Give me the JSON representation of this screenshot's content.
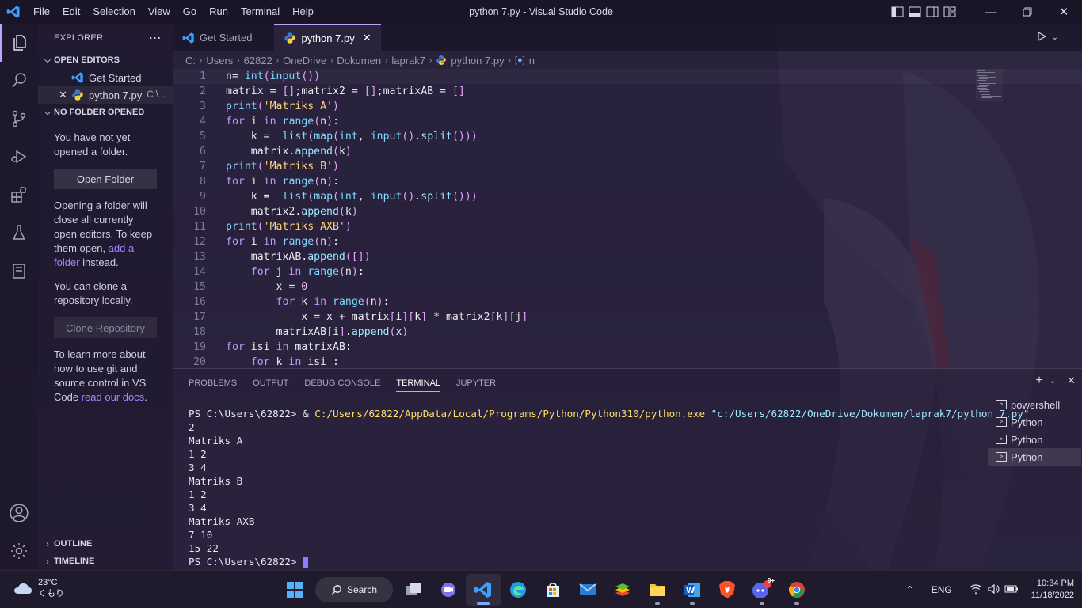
{
  "window": {
    "title": "python 7.py - Visual Studio Code",
    "menu": [
      "File",
      "Edit",
      "Selection",
      "View",
      "Go",
      "Run",
      "Terminal",
      "Help"
    ]
  },
  "sidebar": {
    "header": "EXPLORER",
    "open_editors_label": "OPEN EDITORS",
    "open_editors": [
      {
        "name": "Get Started",
        "path": ""
      },
      {
        "name": "python 7.py",
        "path": "C:\\..."
      }
    ],
    "no_folder_label": "NO FOLDER OPENED",
    "msg1": "You have not yet opened a folder.",
    "open_folder_btn": "Open Folder",
    "msg2_pre": "Opening a folder will close all currently open editors. To keep them open, ",
    "msg2_link": "add a folder",
    "msg2_post": " instead.",
    "msg3": "You can clone a repository locally.",
    "clone_btn": "Clone Repository",
    "msg4_pre": "To learn more about how to use git and source control in VS Code ",
    "msg4_link": "read our docs",
    "msg4_post": ".",
    "outline_label": "OUTLINE",
    "timeline_label": "TIMELINE"
  },
  "tabs": [
    {
      "label": "Get Started",
      "active": false
    },
    {
      "label": "python 7.py",
      "active": true
    }
  ],
  "breadcrumb": [
    "C:",
    "Users",
    "62822",
    "OneDrive",
    "Dokumen",
    "laprak7",
    "python 7.py",
    "n"
  ],
  "editor": {
    "lines": [
      "n= int(input())",
      "matrix = [];matrix2 = [];matrixAB = []",
      "print('Matriks A')",
      "for i in range(n):",
      "    k =  list(map(int, input().split()))",
      "    matrix.append(k)",
      "print('Matriks B')",
      "for i in range(n):",
      "    k =  list(map(int, input().split()))",
      "    matrix2.append(k)",
      "print('Matriks AXB')",
      "for i in range(n):",
      "    matrixAB.append([])",
      "    for j in range(n):",
      "        x = 0",
      "        for k in range(n):",
      "            x = x + matrix[i][k] * matrix2[k][j]",
      "        matrixAB[i].append(x)",
      "for isi in matrixAB:",
      "    for k in isi :"
    ]
  },
  "panel": {
    "tabs": [
      "PROBLEMS",
      "OUTPUT",
      "DEBUG CONSOLE",
      "TERMINAL",
      "JUPYTER"
    ],
    "active_tab": "TERMINAL",
    "terminal": {
      "prompt": "PS C:\\Users\\62822> ",
      "cmd_amp": "& ",
      "cmd_exe": "C:/Users/62822/AppData/Local/Programs/Python/Python310/python.exe",
      "cmd_arg": "\"c:/Users/62822/OneDrive/Dokumen/laprak7/python 7.py\"",
      "output": [
        "2",
        "Matriks A",
        "1 2",
        "3 4",
        "Matriks B",
        "1 2",
        "3 4",
        "Matriks AXB",
        "7 10",
        "15 22"
      ],
      "final_prompt": "PS C:\\Users\\62822> "
    },
    "terminal_list": [
      "powershell",
      "Python",
      "Python",
      "Python"
    ]
  },
  "taskbar": {
    "temp": "23°C",
    "weather": "くもり",
    "search": "Search",
    "lang": "ENG",
    "time": "10:34 PM",
    "date": "11/18/2022",
    "badge": "9+"
  },
  "colors": {
    "accent": "#b9a6ff",
    "vscode_blue": "#3ba1ff"
  }
}
